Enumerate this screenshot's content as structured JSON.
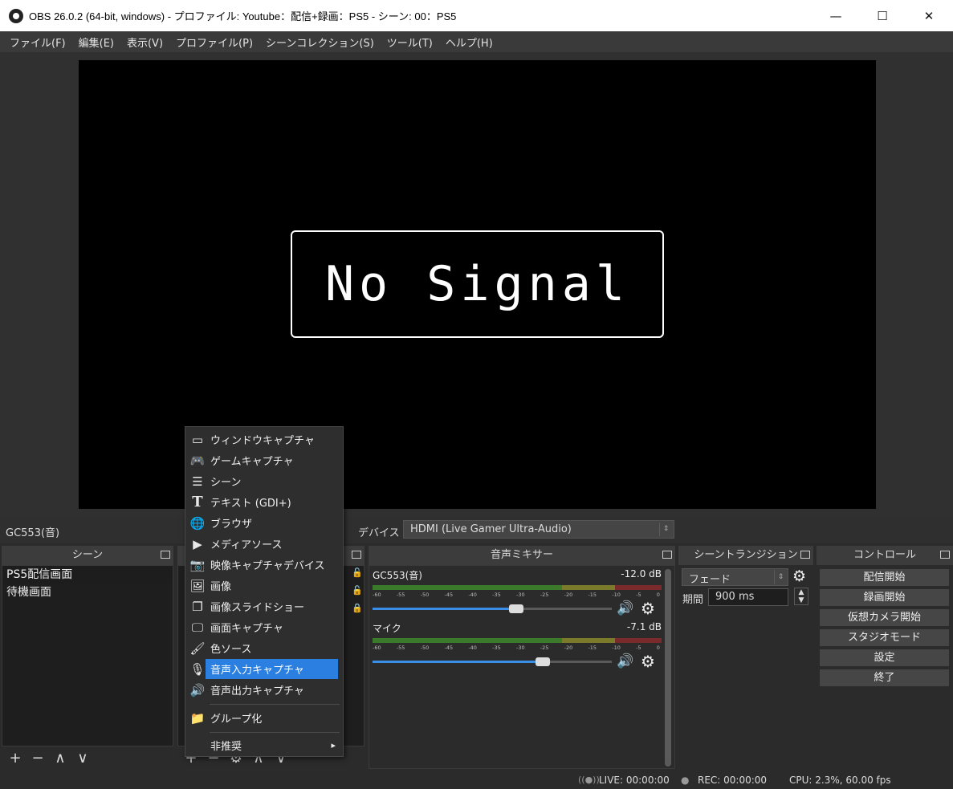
{
  "window": {
    "title": "OBS 26.0.2 (64-bit, windows) - プロファイル: Youtube：配信+録画：PS5 - シーン: 00：PS5",
    "minimize": "—",
    "maximize": "☐",
    "close": "✕"
  },
  "menu": [
    "ファイル(F)",
    "編集(E)",
    "表示(V)",
    "プロファイル(P)",
    "シーンコレクション(S)",
    "ツール(T)",
    "ヘルプ(H)"
  ],
  "preview": {
    "text": "No Signal"
  },
  "source_toolbar": {
    "source_name": "GC553(音)",
    "device_label": "デバイス",
    "device_value": "HDMI (Live Gamer Ultra-Audio)"
  },
  "scenes": {
    "header": "シーン",
    "items": [
      "PS5配信画面",
      "待機画面"
    ],
    "tools": [
      "+",
      "−",
      "∧",
      "∨"
    ]
  },
  "sources": {
    "tools": [
      "+",
      "−",
      "⚙",
      "∧",
      "∨"
    ]
  },
  "context_menu": {
    "items": [
      {
        "icon": "window-icon",
        "glyph": "▭",
        "label": "ウィンドウキャプチャ"
      },
      {
        "icon": "gamepad-icon",
        "glyph": "🎮",
        "label": "ゲームキャプチャ"
      },
      {
        "icon": "list-icon",
        "glyph": "☰",
        "label": "シーン"
      },
      {
        "icon": "text-icon",
        "glyph": "T",
        "label": "テキスト (GDI+)"
      },
      {
        "icon": "globe-icon",
        "glyph": "🌐",
        "label": "ブラウザ"
      },
      {
        "icon": "play-icon",
        "glyph": "▶",
        "label": "メディアソース"
      },
      {
        "icon": "camera-icon",
        "glyph": "📷",
        "label": "映像キャプチャデバイス"
      },
      {
        "icon": "image-icon",
        "glyph": "🖼",
        "label": "画像"
      },
      {
        "icon": "slideshow-icon",
        "glyph": "❐",
        "label": "画像スライドショー"
      },
      {
        "icon": "monitor-icon",
        "glyph": "🖵",
        "label": "画面キャプチャ"
      },
      {
        "icon": "brush-icon",
        "glyph": "🖌",
        "label": "色ソース"
      },
      {
        "icon": "microphone-icon",
        "glyph": "🎙",
        "label": "音声入力キャプチャ"
      },
      {
        "icon": "speaker-icon",
        "glyph": "🔊",
        "label": "音声出力キャプチャ"
      },
      {
        "icon": "folder-icon",
        "glyph": "📁",
        "label": "グループ化"
      },
      {
        "icon": "",
        "glyph": "",
        "label": "非推奨"
      }
    ],
    "highlighted": "音声入力キャプチャ",
    "submenu_arrow": "▸"
  },
  "mixer": {
    "header": "音声ミキサー",
    "scale": [
      "-60",
      "-55",
      "-50",
      "-45",
      "-40",
      "-35",
      "-30",
      "-25",
      "-20",
      "-15",
      "-10",
      "-5",
      "0"
    ],
    "channels": [
      {
        "name": "GC553(音)",
        "db": "-12.0 dB",
        "level": 0.6
      },
      {
        "name": "マイク",
        "db": "-7.1 dB",
        "level": 0.71
      }
    ]
  },
  "transitions": {
    "header": "シーントランジション",
    "type": "フェード",
    "duration_label": "期間",
    "duration_value": "900 ms"
  },
  "controls": {
    "header": "コントロール",
    "buttons": [
      "配信開始",
      "録画開始",
      "仮想カメラ開始",
      "スタジオモード",
      "設定",
      "終了"
    ]
  },
  "status": {
    "live": "LIVE: 00:00:00",
    "rec": "REC: 00:00:00",
    "cpu": "CPU: 2.3%, 60.00 fps"
  },
  "colors": {
    "accent": "#2a7fe0",
    "fader_fill": "#3a8ee6",
    "panel_bg": "#2b2b2b"
  }
}
